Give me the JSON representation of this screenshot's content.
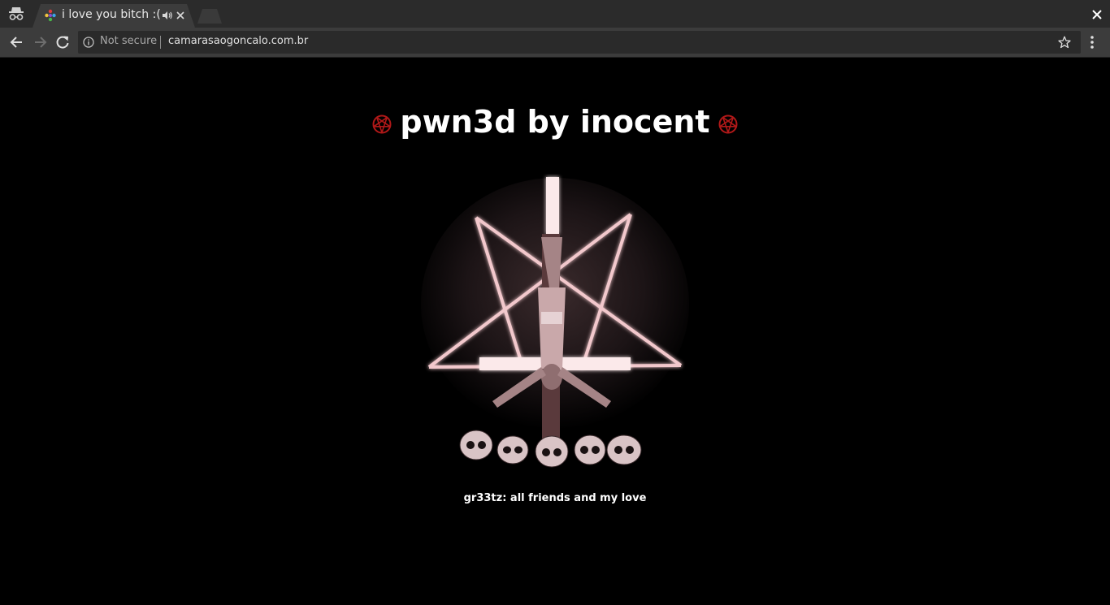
{
  "browser": {
    "tab": {
      "title": "i love you bitch :("
    },
    "address": {
      "security_label": "Not secure",
      "url": "camarasaogoncalo.com.br"
    },
    "icons": {
      "incognito": "incognito-icon",
      "favicon": "site-favicon",
      "audio": "speaker-icon",
      "tab_close": "close-icon",
      "window_close": "close-icon",
      "back": "back-arrow-icon",
      "forward": "forward-arrow-icon",
      "reload": "reload-icon",
      "info": "info-icon",
      "bookmark": "star-icon",
      "menu": "kebab-menu-icon"
    }
  },
  "page": {
    "headline": "pwn3d by inocent",
    "greetz": "gr33tz: all friends and my love",
    "colors": {
      "background": "#000000",
      "pentagram_red": "#b01818",
      "neon_pink": "#f2c8cc"
    }
  }
}
